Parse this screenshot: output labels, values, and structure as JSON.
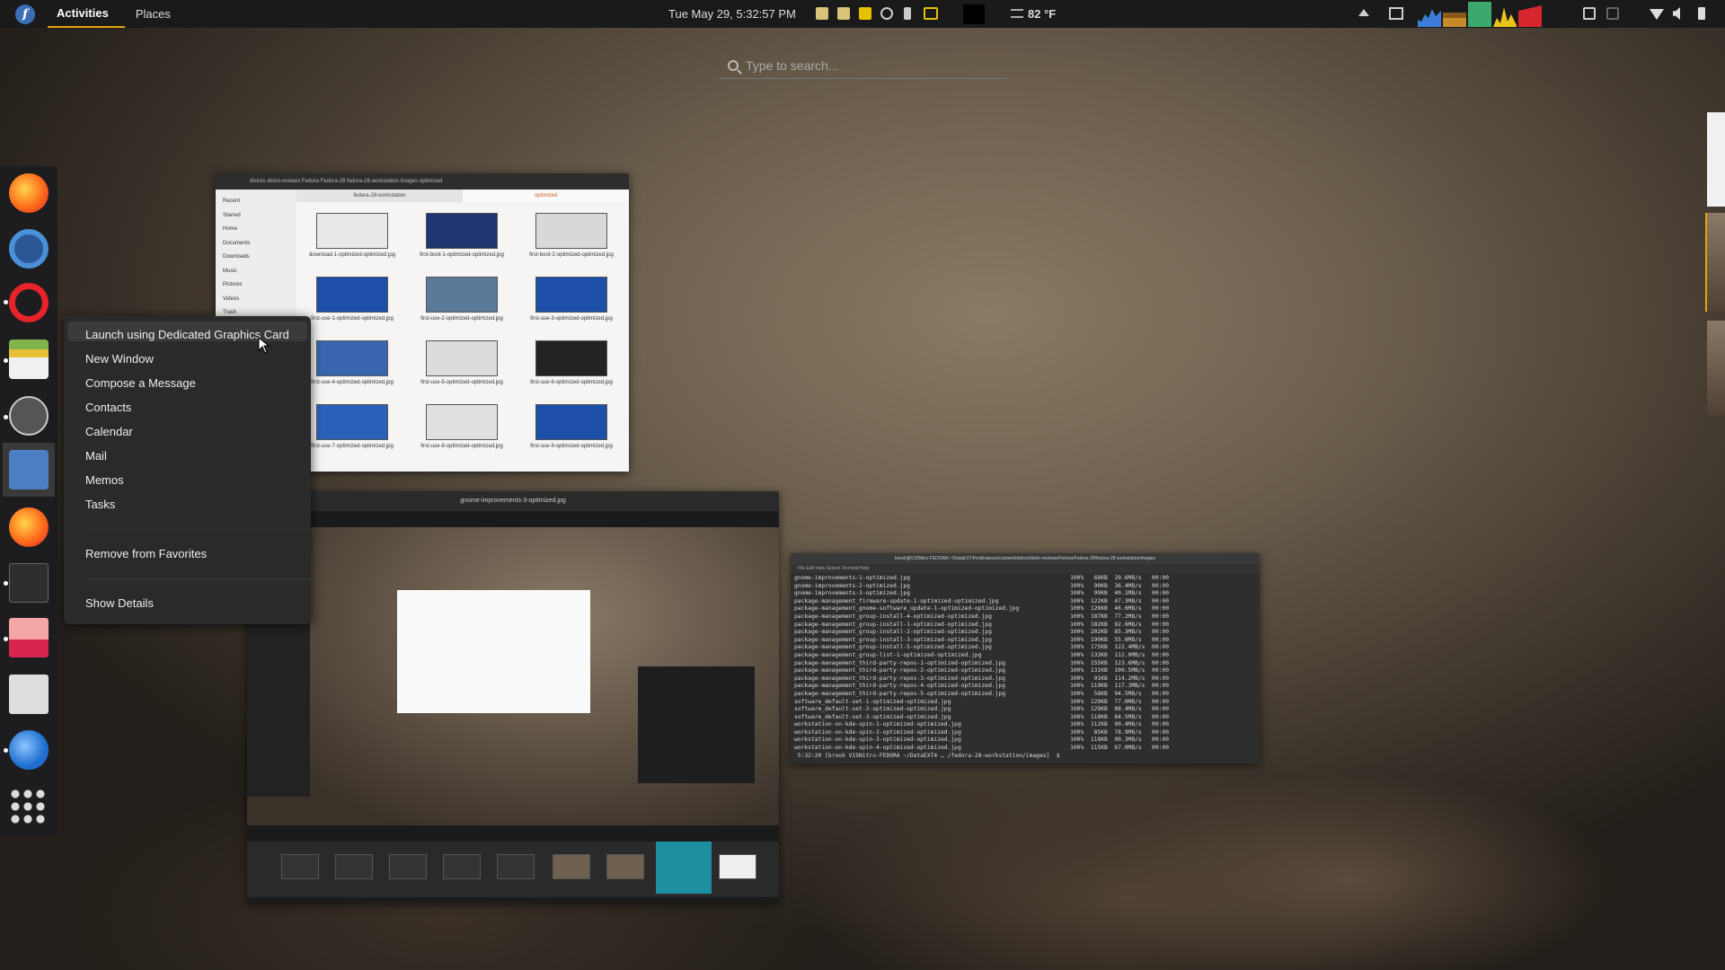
{
  "topbar": {
    "activities": "Activities",
    "places": "Places",
    "clock": "Tue May 29,  5:32:57 PM",
    "weather": "82 °F",
    "accent": "#e5a50a"
  },
  "search": {
    "placeholder": "Type to search..."
  },
  "dock": {
    "items": [
      "firefox-icon",
      "settings-icon",
      "opera-icon",
      "files-icon",
      "atom-icon",
      "mail-icon",
      "firefox-icon",
      "terminal-icon",
      "screenshot-icon",
      "inkscape-icon",
      "thunderbird-icon",
      "app-grid-icon"
    ]
  },
  "context_menu": {
    "items": [
      "Launch using Dedicated Graphics Card",
      "New Window",
      "Compose a Message",
      "Contacts",
      "Calendar",
      "Mail",
      "Memos",
      "Tasks"
    ],
    "remove": "Remove from Favorites",
    "details": "Show Details"
  },
  "nautilus": {
    "path": "distros  distro-reviews  Fedora  Fedora-28  fedora-28-workstation  images  optimized",
    "sidebar": [
      "Recent",
      "Starred",
      "Home",
      "Documents",
      "Downloads",
      "Music",
      "Pictures",
      "Videos",
      "Trash"
    ],
    "tabs": [
      "fedora-28-workstation",
      "optimized"
    ],
    "files": [
      "download-1-optimized-optimized.jpg",
      "first-boot-1-optimized-optimized.jpg",
      "first-boot-2-optimized-optimized.jpg",
      "first-use-1-optimized-optimized.jpg",
      "first-use-2-optimized-optimized.jpg",
      "first-use-3-optimized-optimized.jpg",
      "first-use-4-optimized-optimized.jpg",
      "first-use-5-optimized-optimized.jpg",
      "first-use-6-optimized-optimized.jpg",
      "first-use-7-optimized-optimized.jpg",
      "first-use-8-optimized-optimized.jpg",
      "first-use-9-optimized-optimized.jpg"
    ]
  },
  "viewer": {
    "title": "gnome-improvements-3-optimized.jpg"
  },
  "terminal": {
    "title": "brook@V15Nitro-FEDORA:~/DataEXT4/ordinateurs/content/distros/distro-reviews/Fedora/Fedora-28/fedora-28-workstation/images",
    "menu": "File   Edit   View   Search   Terminal   Help",
    "lines": [
      "gnome-improvements-1-optimized.jpg                                               100%   68KB  39.6MB/s   00:00",
      "gnome-improvements-2-optimized.jpg                                               100%   90KB  36.4MB/s   00:00",
      "gnome-improvements-3-optimized.jpg                                               100%   99KB  40.1MB/s   00:00",
      "package-management_firmware-update-1-optimized-optimized.jpg                     100%  122KB  47.3MB/s   00:00",
      "package-management_gnome-software_update-1-optimized-optimized.jpg               100%  126KB  46.6MB/s   00:00",
      "package-management_group-install-4-optimized-optimized.jpg                       100%  187KB  77.2MB/s   00:00",
      "package-management_group-install-1-optimized-optimized.jpg                       100%  182KB  92.6MB/s   00:00",
      "package-management_group-install-2-optimized-optimized.jpg                       100%  202KB  85.3MB/s   00:00",
      "package-management_group-install-3-optimized-optimized.jpg                       100%  190KB  55.0MB/s   00:00",
      "package-management_group-install-5-optimized-optimized.jpg                       100%  175KB  122.4MB/s  00:00",
      "package-management_group-list-1-optimized-optimized.jpg                          100%  133KB  112.0MB/s  00:00",
      "package-management_third-party-repos-1-optimized-optimized.jpg                   100%  155KB  123.6MB/s  00:00",
      "package-management_third-party-repos-2-optimized-optimized.jpg                   100%  131KB  100.5MB/s  00:00",
      "package-management_third-party-repos-3-optimized-optimized.jpg                   100%   91KB  114.2MB/s  00:00",
      "package-management_third-party-repos-4-optimized-optimized.jpg                   100%  119KB  117.3MB/s  00:00",
      "package-management_third-party-repos-5-optimized-optimized.jpg                   100%   58KB  94.5MB/s   00:00",
      "software_default-set-1-optimized-optimized.jpg                                   100%  129KB  77.0MB/s   00:00",
      "software_default-set-2-optimized-optimized.jpg                                   100%  129KB  88.4MB/s   00:00",
      "software_default-set-3-optimized-optimized.jpg                                   100%  118KB  84.5MB/s   00:00",
      "workstation-on-kde-spin-1-optimized-optimized.jpg                                100%  112KB  90.4MB/s   00:00",
      "workstation-on-kde-spin-2-optimized-optimized.jpg                                100%   85KB  78.9MB/s   00:00",
      "workstation-on-kde-spin-3-optimized-optimized.jpg                                100%  118KB  90.3MB/s   00:00",
      "workstation-on-kde-spin-4-optimized-optimized.jpg                                100%  115KB  67.0MB/s   00:00",
      " 5:32:20 [brook V15Nitro-FEDORA ~/DataEXT4 … /fedora-28-workstation/images]  $ "
    ]
  }
}
